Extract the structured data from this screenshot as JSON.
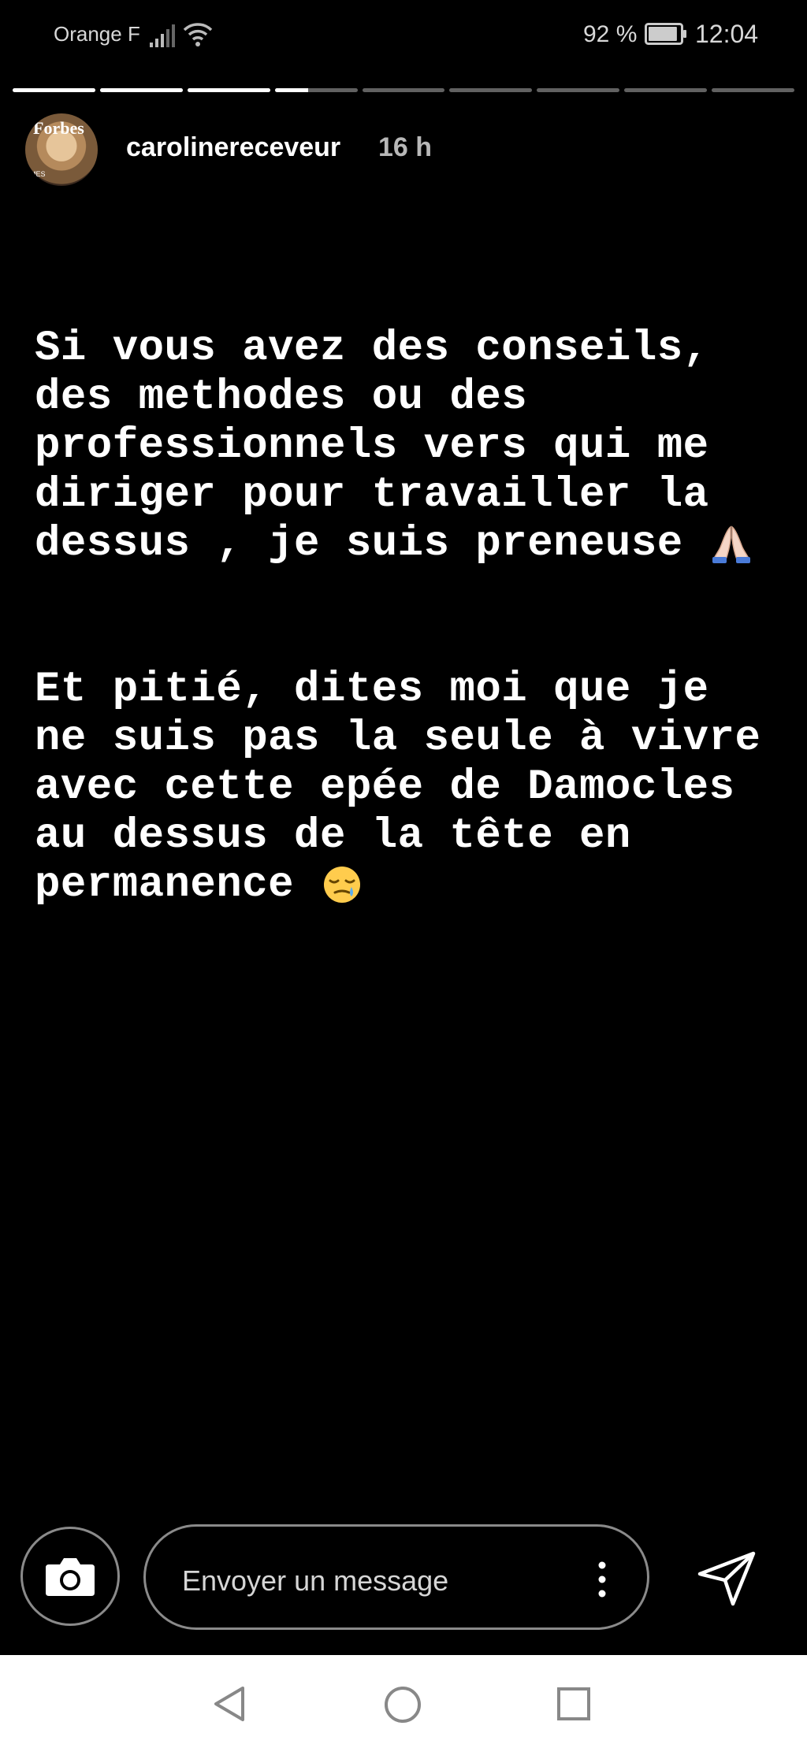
{
  "status_bar": {
    "carrier": "Orange F",
    "battery_percent": "92 %",
    "battery_level": 0.92,
    "time": "12:04"
  },
  "story_progress": {
    "segments": 9,
    "current_index": 3,
    "current_fraction": 0.4
  },
  "header": {
    "avatar_text": "Forbes",
    "avatar_subtext": "MES",
    "username": "carolinereceveur",
    "time_ago": "16 h"
  },
  "story": {
    "paragraph1": "Si vous avez des conseils,\ndes methodes ou des\nprofessionnels vers qui me\ndiriger pour travailler la\ndessus , je suis preneuse",
    "paragraph1_emoji": "praying-hands",
    "paragraph2": "Et pitié, dites moi que je\nne suis pas la seule à vivre\navec cette epée de Damocles\nau dessus de la tête en\npermanence",
    "paragraph2_emoji": "sleepy-face"
  },
  "reply_bar": {
    "placeholder": "Envoyer un message",
    "camera_icon": "camera-icon",
    "more_icon": "more-vertical-icon",
    "send_icon": "send-icon"
  },
  "nav_bar": {
    "back_icon": "back-icon",
    "home_icon": "home-icon",
    "recent_icon": "recent-apps-icon"
  },
  "colors": {
    "background": "#000000",
    "text": "#ffffff",
    "secondary": "#8a8a8a",
    "nav_background": "#ffffff"
  }
}
